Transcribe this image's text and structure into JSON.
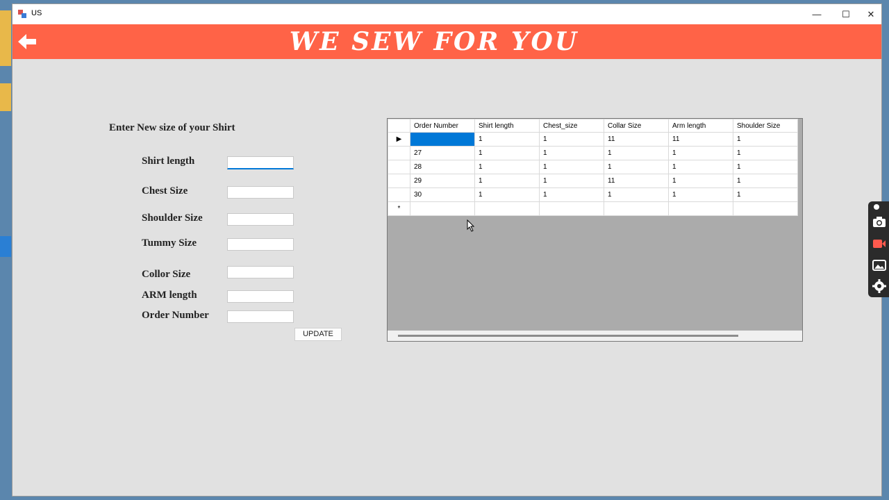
{
  "window": {
    "title": "US"
  },
  "titlebar_buttons": {
    "minimize": "—",
    "maximize": "☐",
    "close": "✕"
  },
  "banner": {
    "heading": "WE SEW FOR YOU",
    "color": "#ff6347"
  },
  "form": {
    "title": "Enter New size of your Shirt",
    "fields": [
      {
        "label": "Shirt length",
        "value": ""
      },
      {
        "label": "Chest Size",
        "value": ""
      },
      {
        "label": "Shoulder Size",
        "value": ""
      },
      {
        "label": "Tummy Size",
        "value": ""
      },
      {
        "label": "Collor Size",
        "value": ""
      },
      {
        "label": "ARM length",
        "value": ""
      },
      {
        "label": "Order Number",
        "value": ""
      }
    ],
    "update_label": "UPDATE"
  },
  "grid": {
    "columns": [
      "Order Number",
      "Shirt length",
      "Chest_size",
      "Collar Size",
      "Arm length",
      "Shoulder Size"
    ],
    "rows": [
      {
        "marker": "▶",
        "cells": [
          "",
          "1",
          "1",
          "11",
          "11",
          "1"
        ]
      },
      {
        "marker": "",
        "cells": [
          "27",
          "1",
          "1",
          "1",
          "1",
          "1"
        ]
      },
      {
        "marker": "",
        "cells": [
          "28",
          "1",
          "1",
          "1",
          "1",
          "1"
        ]
      },
      {
        "marker": "",
        "cells": [
          "29",
          "1",
          "1",
          "11",
          "1",
          "1"
        ]
      },
      {
        "marker": "",
        "cells": [
          "30",
          "1",
          "1",
          "1",
          "1",
          "1"
        ]
      }
    ],
    "new_row_marker": "*",
    "selection_color": "#0078d7"
  },
  "side_toolbar": {
    "icons": [
      "pin-icon",
      "camera-icon",
      "video-icon",
      "gallery-icon",
      "settings-icon"
    ]
  }
}
